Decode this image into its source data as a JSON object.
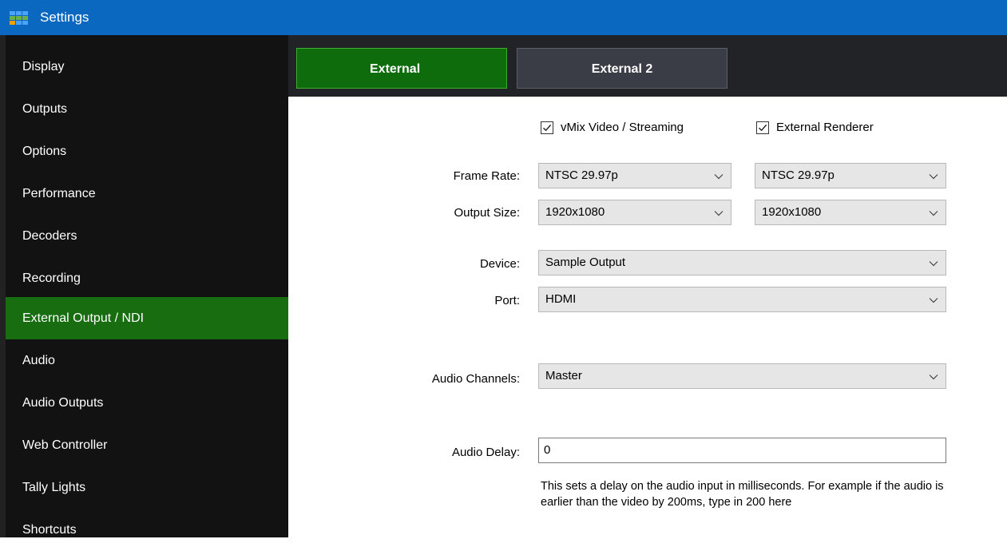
{
  "window": {
    "title": "Settings"
  },
  "colors": {
    "titlebar": "#0a68c0",
    "sidebar": "#121212",
    "active_green": "#176d10",
    "tab_active": "#0f6c0c"
  },
  "sidebar": {
    "items": [
      {
        "label": "Display"
      },
      {
        "label": "Outputs"
      },
      {
        "label": "Options"
      },
      {
        "label": "Performance"
      },
      {
        "label": "Decoders"
      },
      {
        "label": "Recording"
      },
      {
        "label": "External Output / NDI",
        "active": true
      },
      {
        "label": "Audio"
      },
      {
        "label": "Audio Outputs"
      },
      {
        "label": "Web Controller"
      },
      {
        "label": "Tally Lights"
      },
      {
        "label": "Shortcuts"
      }
    ]
  },
  "tabs": [
    {
      "label": "External",
      "active": true
    },
    {
      "label": "External 2",
      "active": false
    }
  ],
  "form": {
    "check_vmix": {
      "label": "vMix Video / Streaming",
      "checked": true
    },
    "check_renderer": {
      "label": "External Renderer",
      "checked": true
    },
    "frame_rate": {
      "label": "Frame Rate:",
      "value1": "NTSC 29.97p",
      "value2": "NTSC 29.97p"
    },
    "output_size": {
      "label": "Output Size:",
      "value1": "1920x1080",
      "value2": "1920x1080"
    },
    "device": {
      "label": "Device:",
      "value": "Sample Output"
    },
    "port": {
      "label": "Port:",
      "value": "HDMI"
    },
    "audio_channels": {
      "label": "Audio Channels:",
      "value": "Master"
    },
    "audio_delay": {
      "label": "Audio Delay:",
      "value": "0"
    },
    "help_text": "This sets a delay on the audio input in milliseconds. For example if the audio is earlier than the video by 200ms, type in 200 here"
  }
}
